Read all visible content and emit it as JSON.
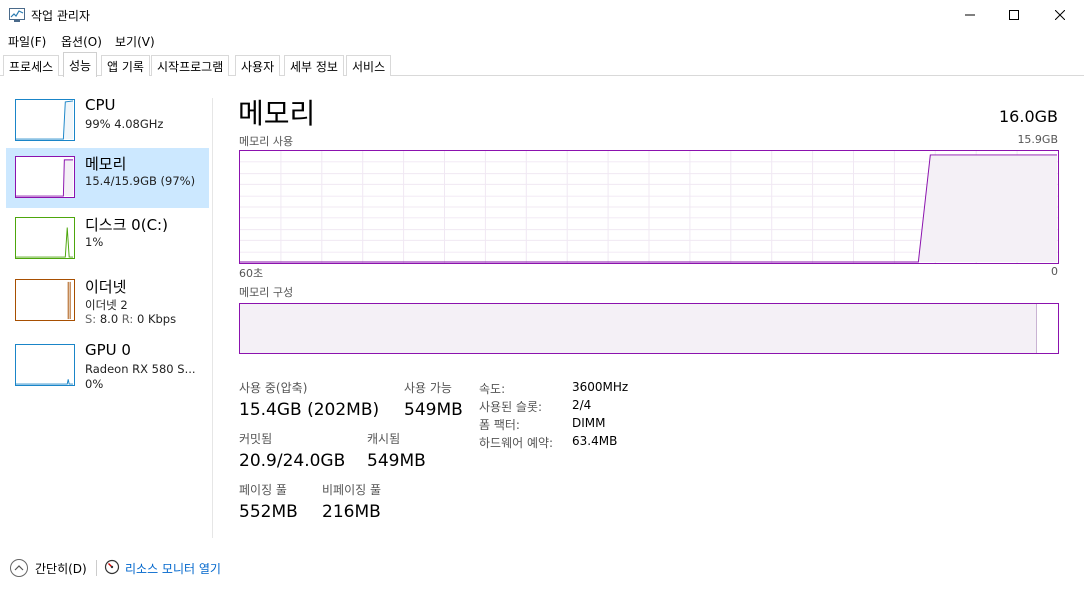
{
  "window": {
    "title": "작업 관리자",
    "app_icon": "task-manager-icon",
    "controls": [
      "minimize-icon",
      "maximize-icon",
      "close-icon"
    ]
  },
  "menu": {
    "items": [
      {
        "label": "파일(F)"
      },
      {
        "label": "옵션(O)"
      },
      {
        "label": "보기(V)"
      }
    ]
  },
  "tabs": [
    {
      "label": "프로세스"
    },
    {
      "label": "성능",
      "active": true
    },
    {
      "label": "앱 기록"
    },
    {
      "label": "시작프로그램"
    },
    {
      "label": "사용자"
    },
    {
      "label": "세부 정보"
    },
    {
      "label": "서비스"
    }
  ],
  "sidebar": {
    "items": [
      {
        "title": "CPU",
        "sub1": "99% 4.08GHz",
        "color": "#1a85c8",
        "level": 0.99
      },
      {
        "title": "메모리",
        "sub1": "15.4/15.9GB (97%)",
        "color": "#8b12ae",
        "level": 0.97,
        "selected": true
      },
      {
        "title": "디스크 0(C:)",
        "sub1": "1%",
        "color": "#4da60c",
        "level": 0.01
      },
      {
        "title": "이더넷",
        "sub1": "이더넷 2",
        "sub2_s_label": "S:",
        "sub2_s_value": "8.0",
        "sub2_r_label": "R:",
        "sub2_r_value": "0 Kbps",
        "color": "#a74f01",
        "level": 0.0
      },
      {
        "title": "GPU 0",
        "sub1": "Radeon RX 580 S...",
        "sub2": "0%",
        "color": "#1a85c8",
        "level": 0.0
      }
    ]
  },
  "main": {
    "title": "메모리",
    "total": "16.0GB",
    "usage_graph": {
      "label": "메모리 사용",
      "max_label": "15.9GB",
      "time_left": "60초",
      "time_right": "0",
      "color": "#8b12ae"
    },
    "composition_graph": {
      "label": "메모리 구성",
      "in_use_fraction": 0.974
    },
    "stats": {
      "in_use_label": "사용 중(압축)",
      "in_use_value": "15.4GB (202MB)",
      "available_label": "사용 가능",
      "available_value": "549MB",
      "committed_label": "커밋됨",
      "committed_value": "20.9/24.0GB",
      "cached_label": "캐시됨",
      "cached_value": "549MB",
      "paged_label": "페이징 풀",
      "paged_value": "552MB",
      "nonpaged_label": "비페이징 풀",
      "nonpaged_value": "216MB"
    },
    "specs": [
      {
        "key": "속도:",
        "value": "3600MHz"
      },
      {
        "key": "사용된 슬롯:",
        "value": "2/4"
      },
      {
        "key": "폼 팩터:",
        "value": "DIMM"
      },
      {
        "key": "하드웨어 예약:",
        "value": "63.4MB"
      }
    ]
  },
  "bottom": {
    "fewer_details": "간단히(D)",
    "resource_monitor": "리소스 모니터 열기"
  }
}
